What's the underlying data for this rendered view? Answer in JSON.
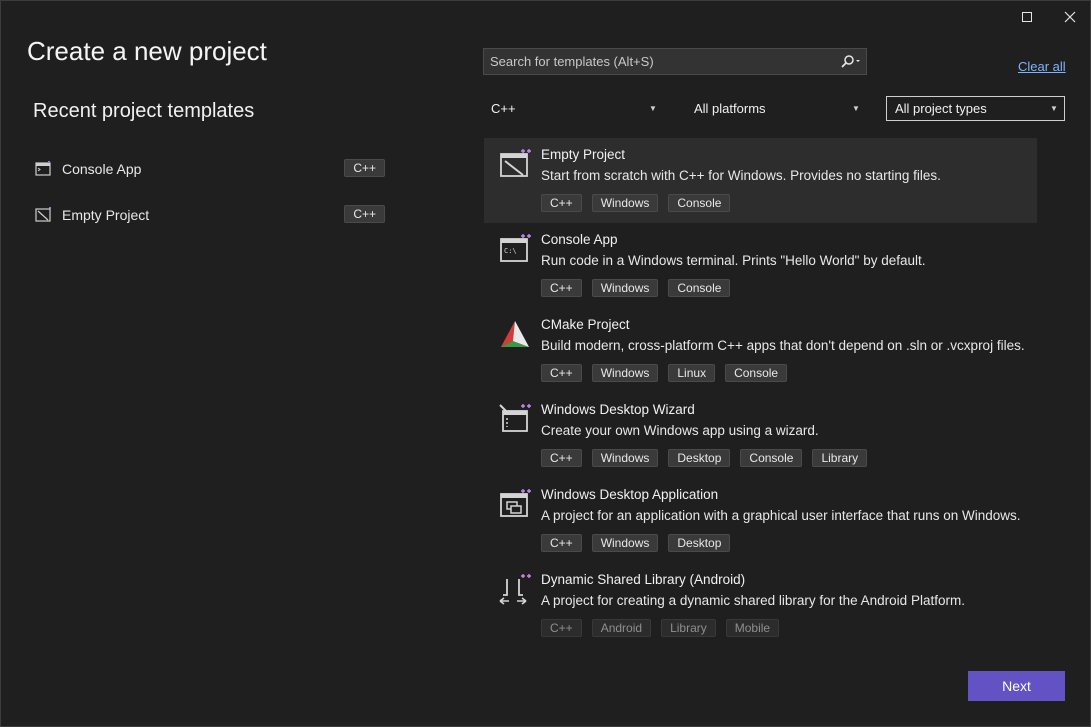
{
  "window": {
    "maximize_icon": "maximize-icon",
    "close_icon": "close-icon"
  },
  "header": {
    "title": "Create a new project"
  },
  "recent": {
    "title": "Recent project templates",
    "items": [
      {
        "name": "Console App",
        "tag": "C++",
        "icon": "console-app-icon"
      },
      {
        "name": "Empty Project",
        "tag": "C++",
        "icon": "empty-project-icon"
      }
    ]
  },
  "search": {
    "placeholder": "Search for templates (Alt+S)",
    "value": "",
    "icon": "search-icon"
  },
  "clear_all": "Clear all",
  "filters": {
    "language": "C++",
    "platform": "All platforms",
    "project_type": "All project types"
  },
  "templates": [
    {
      "name": "Empty Project",
      "description": "Start from scratch with C++ for Windows. Provides no starting files.",
      "tags": [
        "C++",
        "Windows",
        "Console"
      ],
      "icon": "empty-project-icon",
      "selected": true
    },
    {
      "name": "Console App",
      "description": "Run code in a Windows terminal. Prints \"Hello World\" by default.",
      "tags": [
        "C++",
        "Windows",
        "Console"
      ],
      "icon": "console-app-icon"
    },
    {
      "name": "CMake Project",
      "description": "Build modern, cross-platform C++ apps that don't depend on .sln or .vcxproj files.",
      "tags": [
        "C++",
        "Windows",
        "Linux",
        "Console"
      ],
      "icon": "cmake-icon"
    },
    {
      "name": "Windows Desktop Wizard",
      "description": "Create your own Windows app using a wizard.",
      "tags": [
        "C++",
        "Windows",
        "Desktop",
        "Console",
        "Library"
      ],
      "icon": "wizard-icon"
    },
    {
      "name": "Windows Desktop Application",
      "description": "A project for an application with a graphical user interface that runs on Windows.",
      "tags": [
        "C++",
        "Windows",
        "Desktop"
      ],
      "icon": "desktop-app-icon"
    },
    {
      "name": "Dynamic Shared Library (Android)",
      "description": "A project for creating a dynamic shared library for the Android Platform.",
      "tags": [
        "C++",
        "Android",
        "Library",
        "Mobile"
      ],
      "icon": "shared-library-icon"
    }
  ],
  "footer": {
    "next_label": "Next"
  },
  "colors": {
    "accent": "#6252c4",
    "link": "#7eb3ff",
    "background": "#1f1f1f"
  }
}
